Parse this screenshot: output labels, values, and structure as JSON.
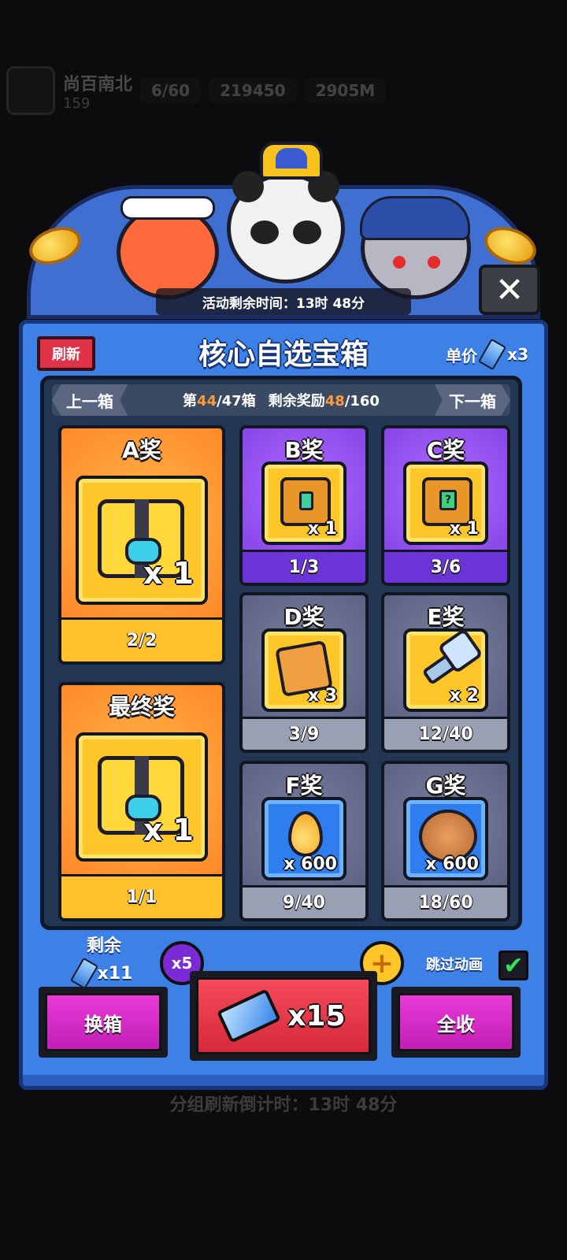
{
  "background": {
    "player_name": "尚百南北",
    "player_level": "159",
    "energy": "6/60",
    "gold": "219450",
    "power": "2905M",
    "group_refresh_countdown": "分组刷新倒计时：13时 48分"
  },
  "event": {
    "remaining_time": "活动剩余时间：13时 48分"
  },
  "panel": {
    "refresh_label": "刷新",
    "title": "核心自选宝箱",
    "unit_price_label": "单价",
    "unit_price_qty": "x3",
    "nav": {
      "prev_label": "上一箱",
      "next_label": "下一箱",
      "box_prefix": "第",
      "box_current": "44",
      "box_suffix": "/47箱",
      "reward_prefix": "剩余奖励",
      "reward_current": "48",
      "reward_suffix": "/160"
    }
  },
  "prizes": {
    "a": {
      "title": "A奖",
      "qty": "x 1",
      "count": "2/2"
    },
    "b": {
      "title": "B奖",
      "qty": "x 1",
      "count": "1/3"
    },
    "c": {
      "title": "C奖",
      "qty": "x 1",
      "count": "3/6"
    },
    "final": {
      "title": "最终奖",
      "qty": "x 1",
      "count": "1/1"
    },
    "d": {
      "title": "D奖",
      "qty": "x 3",
      "count": "3/9"
    },
    "e": {
      "title": "E奖",
      "qty": "x 2",
      "count": "12/40"
    },
    "f": {
      "title": "F奖",
      "qty": "x 600",
      "count": "9/40"
    },
    "g": {
      "title": "G奖",
      "qty": "x 600",
      "count": "18/60"
    }
  },
  "footer": {
    "remaining_label": "剩余",
    "remaining_qty": "x11",
    "multiplier": "x5",
    "plus": "+",
    "skip_animation_label": "跳过动画",
    "skip_checked": "✔",
    "swap_label": "换箱",
    "draw_label": "x15",
    "collect_all_label": "全收"
  },
  "colors": {
    "panel_blue": "#3d80e6",
    "refresh_red": "#e0334a",
    "highlight_orange": "#ff9a3a",
    "pink_button": "#e83ad8",
    "check_green": "#38e058"
  }
}
